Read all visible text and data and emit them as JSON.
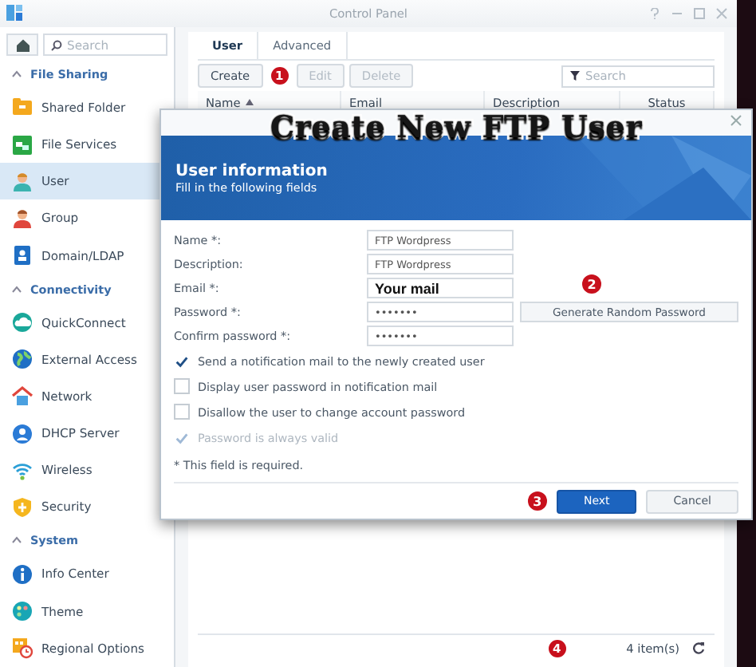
{
  "window": {
    "title": "Control Panel"
  },
  "sidebar": {
    "search": {
      "placeholder": "Search"
    },
    "sections": [
      {
        "title": "File Sharing",
        "expanded": true,
        "items": [
          {
            "label": "Shared Folder",
            "kind": "folder",
            "selected": false
          },
          {
            "label": "File Services",
            "kind": "services",
            "selected": false
          },
          {
            "label": "User",
            "kind": "user",
            "selected": true
          },
          {
            "label": "Group",
            "kind": "group",
            "selected": false
          },
          {
            "label": "Domain/LDAP",
            "kind": "domain",
            "selected": false
          }
        ]
      },
      {
        "title": "Connectivity",
        "expanded": true,
        "items": [
          {
            "label": "QuickConnect",
            "kind": "cloud",
            "selected": false
          },
          {
            "label": "External Access",
            "kind": "globe",
            "selected": false
          },
          {
            "label": "Network",
            "kind": "house",
            "selected": false
          },
          {
            "label": "DHCP Server",
            "kind": "dhcp",
            "selected": false
          },
          {
            "label": "Wireless",
            "kind": "wifi",
            "selected": false
          },
          {
            "label": "Security",
            "kind": "shield",
            "selected": false
          }
        ]
      },
      {
        "title": "System",
        "expanded": true,
        "items": [
          {
            "label": "Info Center",
            "kind": "info",
            "selected": false
          },
          {
            "label": "Theme",
            "kind": "palette",
            "selected": false
          },
          {
            "label": "Regional Options",
            "kind": "clock",
            "selected": false
          }
        ]
      }
    ]
  },
  "main": {
    "tabs": [
      {
        "label": "User",
        "selected": true
      },
      {
        "label": "Advanced",
        "selected": false
      }
    ],
    "toolbar": {
      "buttons": [
        {
          "label": "Create",
          "disabled": false
        },
        {
          "label": "Edit",
          "disabled": true
        },
        {
          "label": "Delete",
          "disabled": true
        }
      ],
      "marker": "1",
      "search": {
        "placeholder": "Search"
      }
    },
    "table": {
      "columns": [
        {
          "label": "Name",
          "sorted": true
        },
        {
          "label": "Email",
          "sorted": false
        },
        {
          "label": "Description",
          "sorted": false
        },
        {
          "label": "Status",
          "sorted": false
        }
      ]
    },
    "status": {
      "count": "4 item(s)",
      "marker": "4"
    }
  },
  "wizard": {
    "caption": "Create New FTP User",
    "title": "User information",
    "subtitle": "Fill in the following fields",
    "marker": "2",
    "fields": [
      {
        "label": "Name *:",
        "value": "FTP Wordpress",
        "kind": "text"
      },
      {
        "label": "Description:",
        "value": "FTP Wordpress",
        "kind": "text"
      },
      {
        "label": "Email *:",
        "value": "Your mail",
        "kind": "highlight"
      },
      {
        "label": "Password *:",
        "value": "•••••••",
        "kind": "password",
        "button": "Generate Random Password"
      },
      {
        "label": "Confirm password *:",
        "value": "•••••••",
        "kind": "password"
      }
    ],
    "options": [
      {
        "label": "Send a notification mail to the newly created user",
        "checked": true,
        "disabled": false
      },
      {
        "label": "Display user password in notification mail",
        "checked": false,
        "disabled": false
      },
      {
        "label": "Disallow the user to change account password",
        "checked": false,
        "disabled": false
      },
      {
        "label": "Password is always valid",
        "checked": true,
        "disabled": true
      }
    ],
    "note": "* This field is required.",
    "footer_marker": "3",
    "buttons": [
      {
        "label": "Next",
        "kind": "primary"
      },
      {
        "label": "Cancel",
        "kind": "secondary"
      }
    ]
  }
}
